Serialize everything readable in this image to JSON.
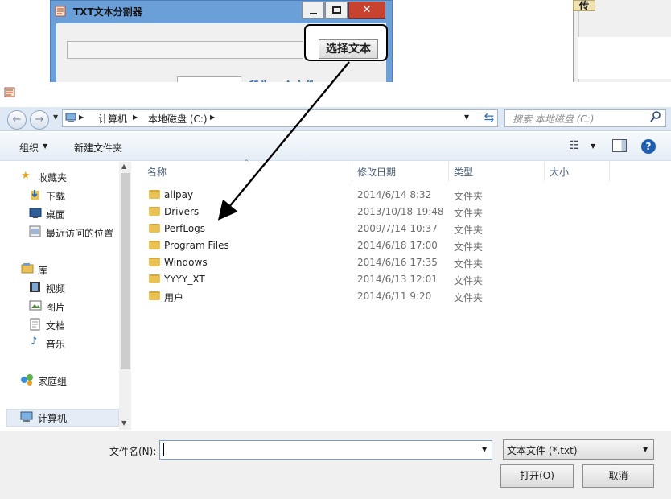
{
  "bg_window": {
    "title": "TXT文本分割器",
    "close_glyph": "✕",
    "choose_button": "选择文本",
    "label": "段为一个文件"
  },
  "right_window": {
    "chip": "传"
  },
  "dialog": {
    "nav": {
      "back": "←",
      "forward": "→",
      "address": [
        "计算机",
        "本地磁盘 (C:)"
      ],
      "search_placeholder": "搜索 本地磁盘 (C:)"
    },
    "toolbar": {
      "organize": "组织",
      "new_folder": "新建文件夹"
    },
    "nav_pane": {
      "favorites": "收藏夹",
      "downloads": "下载",
      "desktop": "桌面",
      "recent": "最近访问的位置",
      "libraries": "库",
      "videos": "视频",
      "pictures": "图片",
      "documents": "文档",
      "music": "音乐",
      "homegroup": "家庭组",
      "computer": "计算机"
    },
    "columns": {
      "name": "名称",
      "date": "修改日期",
      "type": "类型",
      "size": "大小"
    },
    "files": [
      {
        "name": "alipay",
        "date": "2014/6/14 8:32",
        "type": "文件夹"
      },
      {
        "name": "Drivers",
        "date": "2013/10/18 19:48",
        "type": "文件夹"
      },
      {
        "name": "PerfLogs",
        "date": "2009/7/14 10:37",
        "type": "文件夹"
      },
      {
        "name": "Program Files",
        "date": "2014/6/18 17:00",
        "type": "文件夹"
      },
      {
        "name": "Windows",
        "date": "2014/6/16 17:35",
        "type": "文件夹"
      },
      {
        "name": "YYYY_XT",
        "date": "2014/6/13 12:01",
        "type": "文件夹"
      },
      {
        "name": "用户",
        "date": "2014/6/11 9:20",
        "type": "文件夹"
      }
    ],
    "bottom": {
      "filename_label": "文件名(N):",
      "filename_value": "",
      "filetype": "文本文件 (*.txt)",
      "open_button": "打开(O)",
      "cancel_button": "取消"
    }
  },
  "colors": {
    "accent": "#2f6fb5",
    "close": "#c7432f",
    "folder": "#e9c253"
  }
}
